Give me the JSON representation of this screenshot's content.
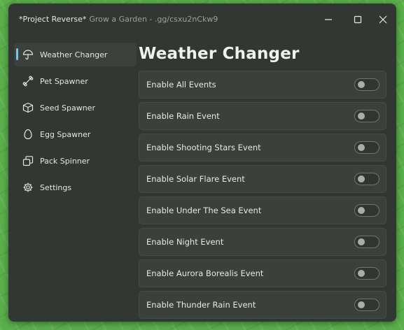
{
  "window": {
    "title": "*Project Reverse*",
    "subtitle": "Grow a Garden - .gg/csxu2nCkw9"
  },
  "sidebar": {
    "items": [
      {
        "label": "Weather Changer",
        "icon": "umbrella-icon",
        "active": true
      },
      {
        "label": "Pet Spawner",
        "icon": "bone-icon",
        "active": false
      },
      {
        "label": "Seed Spawner",
        "icon": "box-icon",
        "active": false
      },
      {
        "label": "Egg Spawner",
        "icon": "egg-icon",
        "active": false
      },
      {
        "label": "Pack Spinner",
        "icon": "pack-icon",
        "active": false
      },
      {
        "label": "Settings",
        "icon": "gear-icon",
        "active": false
      }
    ]
  },
  "main": {
    "title": "Weather Changer",
    "toggles": [
      {
        "label": "Enable All Events",
        "enabled": false
      },
      {
        "label": "Enable Rain Event",
        "enabled": false
      },
      {
        "label": "Enable Shooting Stars Event",
        "enabled": false
      },
      {
        "label": "Enable Solar Flare Event",
        "enabled": false
      },
      {
        "label": "Enable Under The Sea Event",
        "enabled": false
      },
      {
        "label": "Enable Night Event",
        "enabled": false
      },
      {
        "label": "Enable Aurora Borealis Event",
        "enabled": false
      },
      {
        "label": "Enable Thunder Rain Event",
        "enabled": false
      }
    ]
  },
  "colors": {
    "accent": "#60cdff",
    "window_bg": "#323733",
    "row_bg": "#3b403c",
    "desktop_bg": "#5ab04b"
  }
}
